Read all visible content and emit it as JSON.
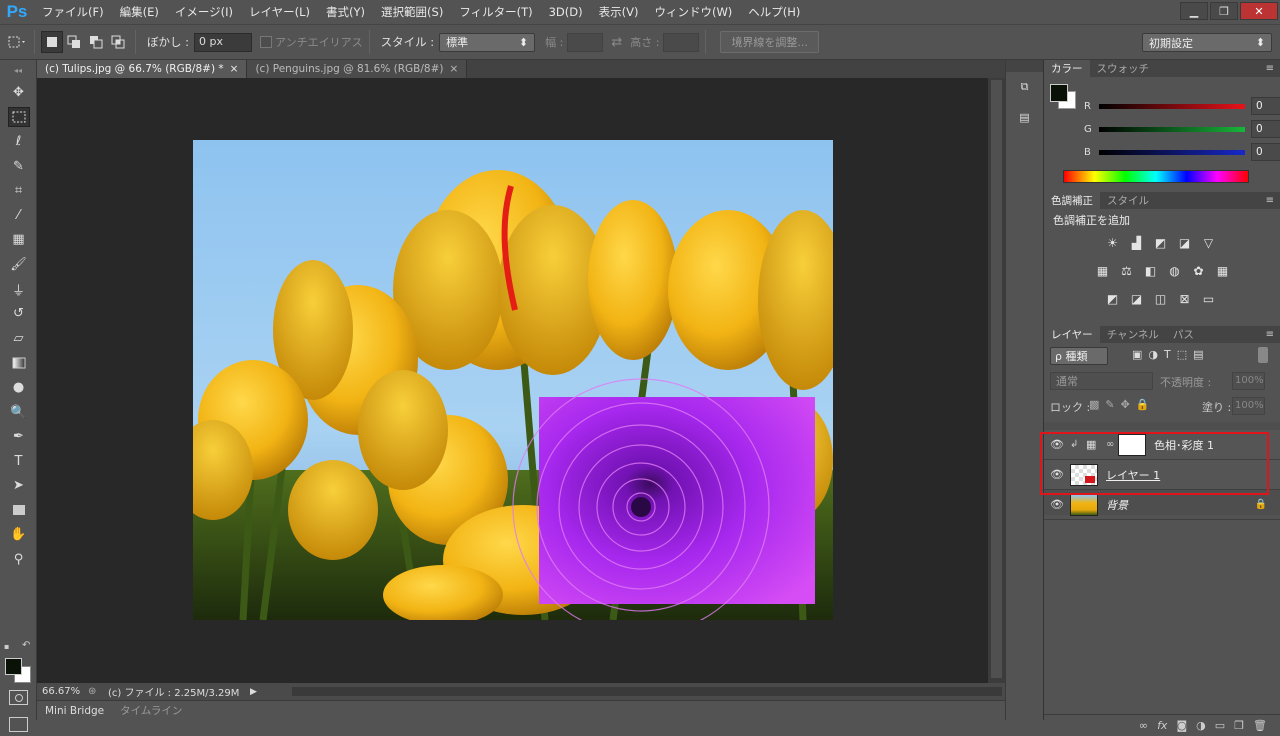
{
  "app": {
    "logo": "Ps"
  },
  "menu": [
    "ファイル(F)",
    "編集(E)",
    "イメージ(I)",
    "レイヤー(L)",
    "書式(Y)",
    "選択範囲(S)",
    "フィルター(T)",
    "3D(D)",
    "表示(V)",
    "ウィンドウ(W)",
    "ヘルプ(H)"
  ],
  "window_controls": {
    "minimize": "▁",
    "restore": "❐",
    "close": "✕"
  },
  "options": {
    "feather_label": "ぼかし :",
    "feather_value": "0 px",
    "antialias_label": "アンチエイリアス",
    "style_label": "スタイル :",
    "style_value": "標準",
    "width_label": "幅 :",
    "height_label": "高さ :",
    "refine_edge": "境界線を調整...",
    "workspace": "初期設定"
  },
  "doc_tabs": [
    {
      "label": "(c) Tulips.jpg @ 66.7% (RGB/8#) *",
      "close": "×"
    },
    {
      "label": "(c) Penguins.jpg @ 81.6% (RGB/8#)",
      "close": "×"
    }
  ],
  "status": {
    "zoom": "66.67%",
    "file": "(c) ファイル : 2.25M/3.29M"
  },
  "bottom_tabs": [
    "Mini Bridge",
    "タイムライン"
  ],
  "color_panel": {
    "tabs": [
      "カラー",
      "スウォッチ"
    ],
    "channels": [
      {
        "name": "R",
        "value": "0"
      },
      {
        "name": "G",
        "value": "0"
      },
      {
        "name": "B",
        "value": "0"
      }
    ]
  },
  "adjustments_panel": {
    "tabs": [
      "色調補正",
      "スタイル"
    ],
    "heading": "色調補正を追加"
  },
  "layers_panel": {
    "tabs": [
      "レイヤー",
      "チャンネル",
      "パス"
    ],
    "filter_kind": "ρ 種類",
    "blend_mode": "通常",
    "opacity_label": "不透明度 :",
    "opacity_value": "100%",
    "lock_label": "ロック :",
    "fill_label": "塗り :",
    "fill_value": "100%",
    "layers": [
      {
        "name": "色相･彩度 1"
      },
      {
        "name": "レイヤー 1"
      },
      {
        "name": "背景"
      }
    ]
  },
  "colors": {
    "highlight_box": "#e0151b",
    "accent": "#31a8ff"
  }
}
